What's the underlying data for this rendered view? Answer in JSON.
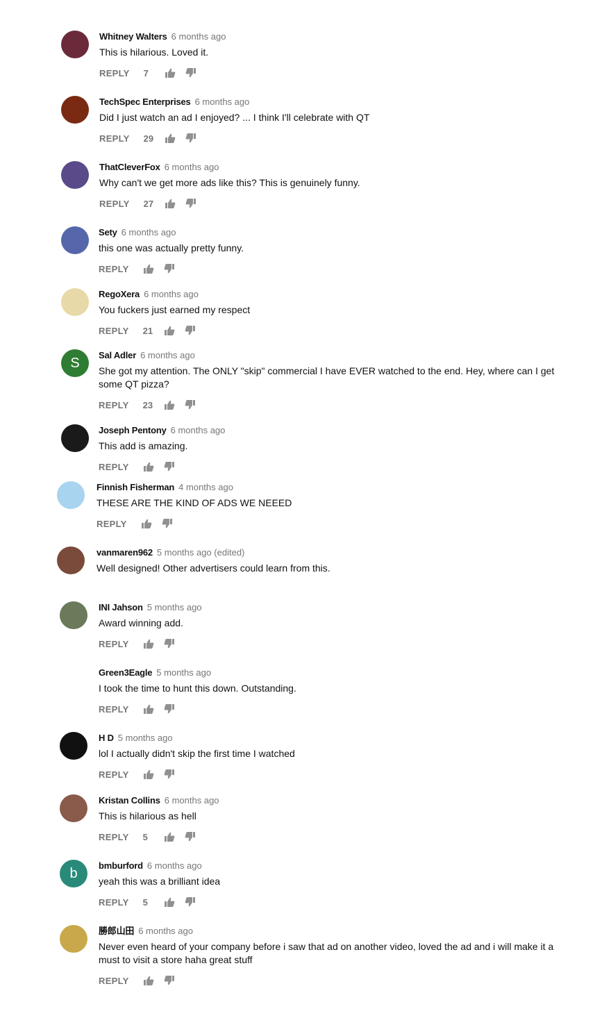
{
  "reply_label": "REPLY",
  "comments": [
    {
      "author": "Whitney Walters",
      "time": "6 months ago",
      "text": "This is hilarious. Loved it.",
      "likes": "7",
      "avatar_color": "#6b2a3a",
      "avatar_letter": ""
    },
    {
      "author": "TechSpec Enterprises",
      "time": "6 months ago",
      "text": "Did I just watch an ad I enjoyed? ... I think I'll celebrate with QT",
      "likes": "29",
      "avatar_color": "#7a2a12",
      "avatar_letter": ""
    },
    {
      "author": "ThatCleverFox",
      "time": "6 months ago",
      "text": "Why can't we get more ads like this? This is genuinely funny.",
      "likes": "27",
      "avatar_color": "#5a4a8a",
      "avatar_letter": ""
    },
    {
      "author": "Sety",
      "time": "6 months ago",
      "text": "this one was actually pretty funny.",
      "likes": "",
      "avatar_color": "#5566aa",
      "avatar_letter": ""
    },
    {
      "author": "RegoXera",
      "time": "6 months ago",
      "text": "You fuckers just earned my respect",
      "likes": "21",
      "avatar_color": "#e8d9a8",
      "avatar_letter": ""
    },
    {
      "author": "Sal Adler",
      "time": "6 months ago",
      "text": "She got my attention. The ONLY \"skip\" commercial I have EVER watched to the end. Hey, where can I get some QT pizza?",
      "likes": "23",
      "avatar_color": "#2e7d32",
      "avatar_letter": "S"
    },
    {
      "author": "Joseph Pentony",
      "time": "6 months ago",
      "text": "This add is amazing.",
      "likes": "",
      "avatar_color": "#1a1a1a",
      "avatar_letter": ""
    },
    {
      "author": "Finnish Fisherman",
      "time": "4 months ago",
      "text": "THESE ARE THE KIND OF ADS WE NEEED",
      "likes": "",
      "avatar_color": "#a8d4ef",
      "avatar_letter": ""
    },
    {
      "author": "vanmaren962",
      "time": "5 months ago (edited)",
      "text": "Well designed!  Other advertisers could learn from this.",
      "likes": "",
      "avatar_color": "#7a4a3a",
      "avatar_letter": ""
    },
    {
      "author": "INI Jahson",
      "time": "5 months ago",
      "text": "Award winning add.",
      "likes": "",
      "avatar_color": "#6a7a5a",
      "avatar_letter": ""
    },
    {
      "author": "Green3Eagle",
      "time": "5 months ago",
      "text": "I took the time to hunt this down. Outstanding.",
      "likes": "",
      "avatar_color": "#ffffff",
      "avatar_letter": ""
    },
    {
      "author": "H D",
      "time": "5 months ago",
      "text": "lol I actually didn't skip the first time I watched",
      "likes": "",
      "avatar_color": "#111111",
      "avatar_letter": ""
    },
    {
      "author": "Kristan Collins",
      "time": "6 months ago",
      "text": "This is hilarious as hell",
      "likes": "5",
      "avatar_color": "#8a5a4a",
      "avatar_letter": ""
    },
    {
      "author": "bmburford",
      "time": "6 months ago",
      "text": "yeah this was a brilliant idea",
      "likes": "5",
      "avatar_color": "#2a8a7a",
      "avatar_letter": "b"
    },
    {
      "author": "勝郎山田",
      "time": "6 months ago",
      "text": "Never even heard of your company before i saw that ad on another video, loved the ad and i will make it a must to visit a store haha great stuff",
      "likes": "",
      "avatar_color": "#c8a84a",
      "avatar_letter": ""
    }
  ]
}
